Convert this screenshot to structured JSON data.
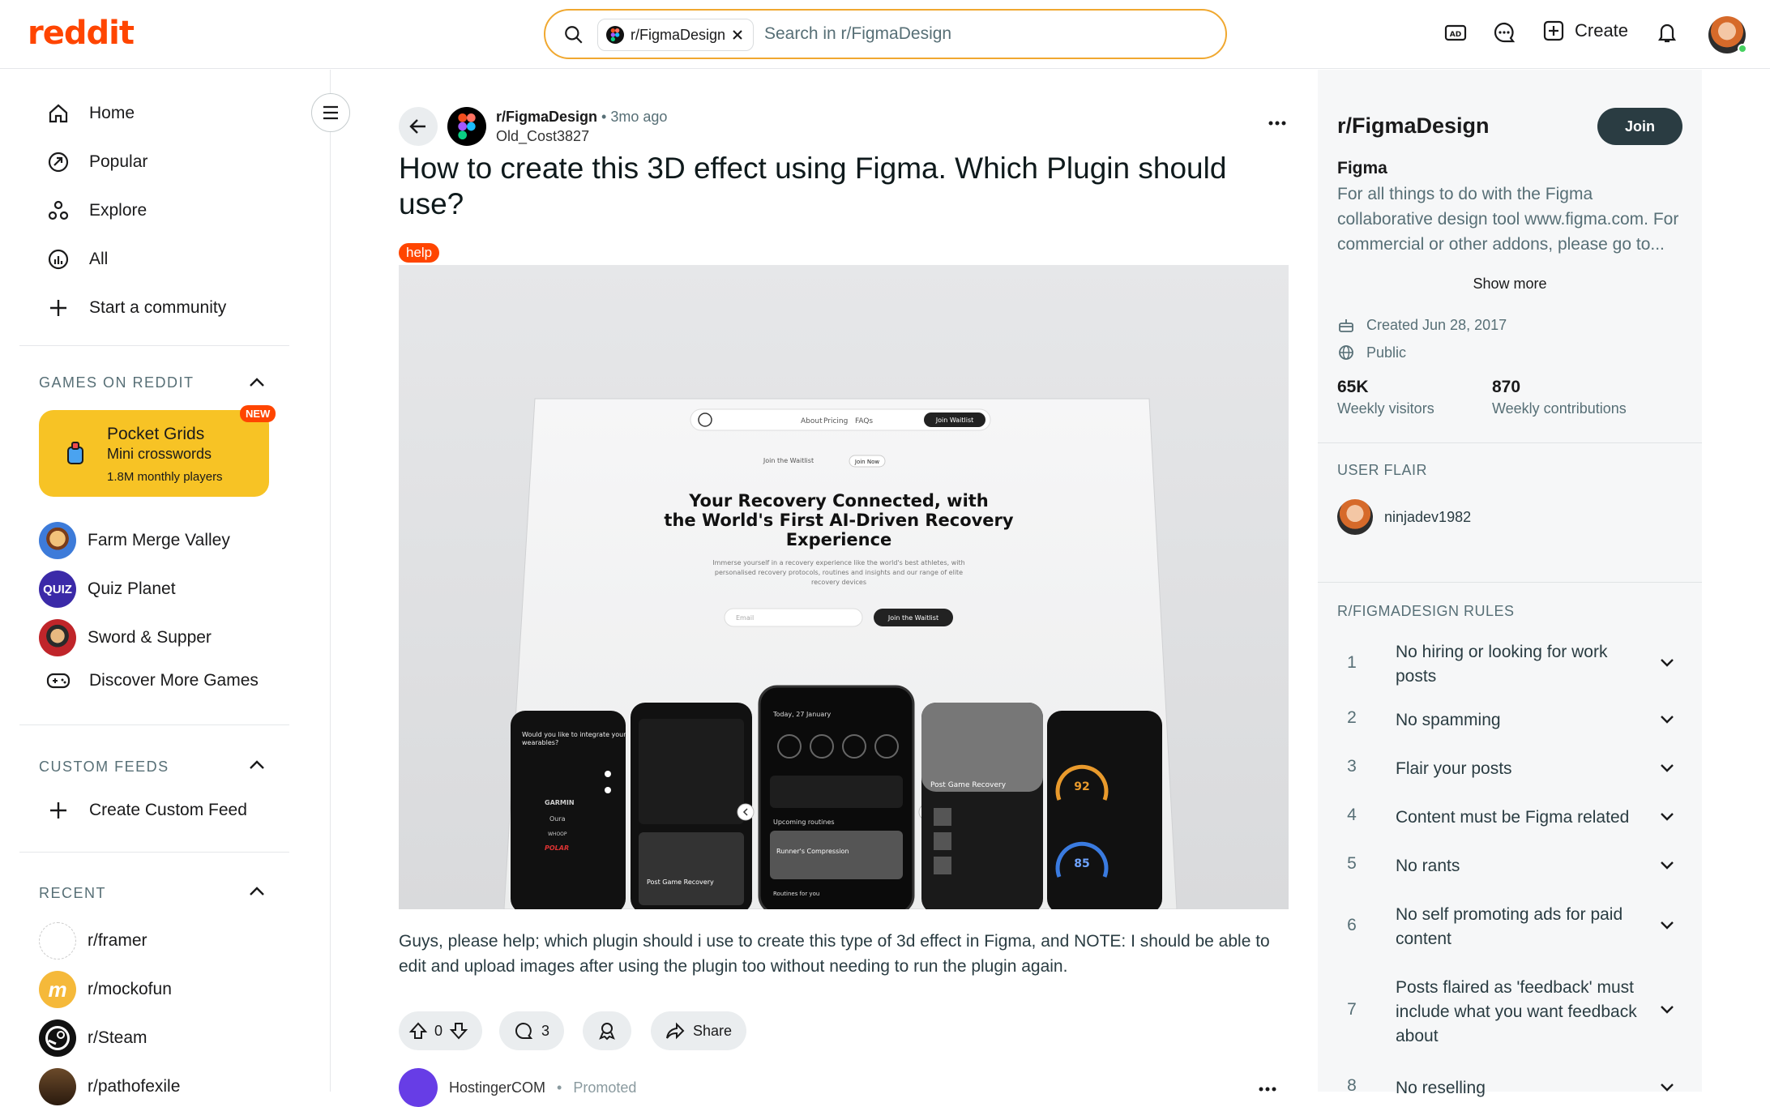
{
  "header": {
    "logo": "reddit",
    "search_chip": "r/FigmaDesign",
    "search_placeholder": "Search in r/FigmaDesign",
    "create_label": "Create"
  },
  "sidebar": {
    "nav": [
      {
        "label": "Home",
        "icon": "home-icon"
      },
      {
        "label": "Popular",
        "icon": "popular-icon"
      },
      {
        "label": "Explore",
        "icon": "explore-icon"
      },
      {
        "label": "All",
        "icon": "all-icon"
      },
      {
        "label": "Start a community",
        "icon": "plus-icon"
      }
    ],
    "games_title": "GAMES ON REDDIT",
    "featured_game": {
      "title": "Pocket Grids",
      "subtitle": "Mini crosswords",
      "players": "1.8M monthly players",
      "badge": "NEW"
    },
    "games": [
      "Farm Merge Valley",
      "Quiz Planet",
      "Sword & Supper",
      "Discover More Games"
    ],
    "custom_feeds_title": "CUSTOM FEEDS",
    "create_custom_feed": "Create Custom Feed",
    "recent_title": "RECENT",
    "recent": [
      "r/framer",
      "r/mockofun",
      "r/Steam",
      "r/pathofexile"
    ]
  },
  "post": {
    "subreddit": "r/FigmaDesign",
    "time": "3mo ago",
    "author": "Old_Cost3827",
    "title": "How to create this 3D effect using Figma. Which Plugin should use?",
    "flair": "help",
    "body": "Guys, please help; which plugin should i use to create this type of 3d effect in Figma, and NOTE: I should be able to edit and upload images after using the plugin too without needing to run the plugin again.",
    "votes": "0",
    "comments": "3",
    "share": "Share",
    "image": {
      "nav": [
        "About",
        "Pricing",
        "FAQs"
      ],
      "nav_cta": "Join Waitlist",
      "pill_left": "Join the Waitlist",
      "pill_right": "Join Now",
      "headline": "Your Recovery Connected, with the World's First AI-Driven Recovery Experience",
      "subhead": "Immerse yourself in a recovery experience like the world's best athletes, with personalised recovery protocols, routines and insights and our range of elite recovery devices",
      "email_placeholder": "Email",
      "cta": "Join the Waitlist",
      "phone1_title": "Would you like to integrate your wearables?",
      "phone_brands": [
        "GARMIN",
        "Oura",
        "WHOOP",
        "POLAR"
      ],
      "phone4_title": "Post Game Recovery",
      "phone5_values": [
        "92",
        "85"
      ]
    }
  },
  "promoted": {
    "name": "HostingerCOM",
    "label": "Promoted"
  },
  "community": {
    "name": "r/FigmaDesign",
    "join": "Join",
    "display_name": "Figma",
    "description": "For all things to do with the Figma collaborative design tool www.figma.com. For commercial or other addons, please go to...",
    "show_more": "Show more",
    "created": "Created Jun 28, 2017",
    "visibility": "Public",
    "weekly_visitors": "65K",
    "weekly_visitors_label": "Weekly visitors",
    "weekly_contributions": "870",
    "weekly_contributions_label": "Weekly contributions",
    "user_flair_title": "USER FLAIR",
    "username": "ninjadev1982",
    "rules_title": "R/FIGMADESIGN RULES",
    "rules": [
      {
        "n": "1",
        "text": "No hiring or looking for work posts"
      },
      {
        "n": "2",
        "text": "No spamming"
      },
      {
        "n": "3",
        "text": "Flair your posts"
      },
      {
        "n": "4",
        "text": "Content must be Figma related"
      },
      {
        "n": "5",
        "text": "No rants"
      },
      {
        "n": "6",
        "text": "No self promoting ads for paid content"
      },
      {
        "n": "7",
        "text": "Posts flaired as 'feedback' must include what you want feedback about"
      },
      {
        "n": "8",
        "text": "No reselling"
      }
    ]
  },
  "colors": {
    "brand": "#ff4500",
    "game_card": "#f7c325",
    "join_button": "#2a3c42"
  }
}
